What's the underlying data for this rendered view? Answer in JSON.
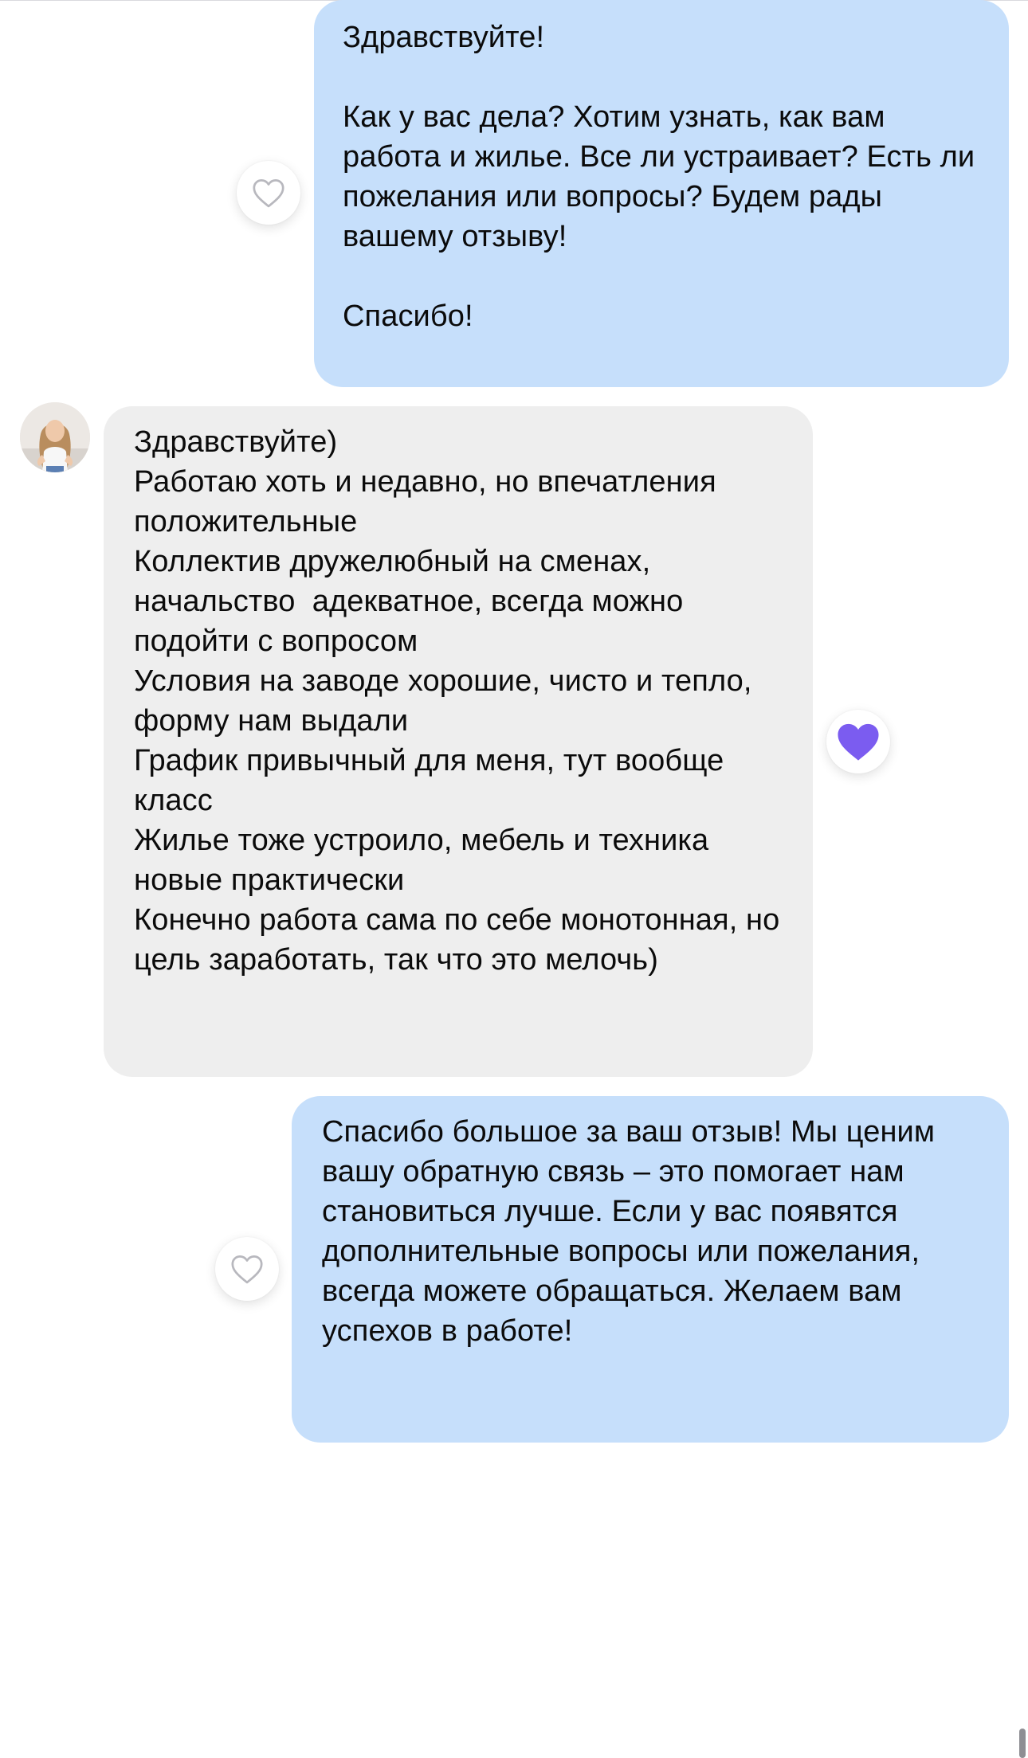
{
  "messages": [
    {
      "direction": "outgoing",
      "text": "Здравствуйте!\n\nКак у вас дела? Хотим узнать, как вам работа и жилье. Все ли устраивает? Есть ли пожелания или вопросы? Будем рады вашему отзыву!\n\nСпасибо!",
      "reaction": "heart-outline-icon"
    },
    {
      "direction": "incoming",
      "text": "Здравствуйте)\nРаботаю хоть и недавно, но впечатления положительные\nКоллектив дружелюбный на сменах, начальство  адекватное, всегда можно подойти с вопросом\nУсловия на заводе хорошие, чисто и тепло, форму нам выдали\nГрафик привычный для меня, тут вообще класс\nЖилье тоже устроило, мебель и техника новые практически\nКонечно работа сама по себе монотонная, но цель заработать, так что это мелочь)",
      "reaction": "heart-filled-icon"
    },
    {
      "direction": "outgoing",
      "text": "Спасибо большое за ваш отзыв! Мы ценим вашу обратную связь – это помогает нам становиться лучше. Если у вас появятся дополнительные вопросы или пожелания, всегда можете обращаться. Желаем вам успехов в работе!",
      "reaction": "heart-outline-icon"
    }
  ],
  "colors": {
    "outgoing_bubble": "#c6dffb",
    "incoming_bubble": "#eeeeee",
    "liked_heart": "#7b5cf0",
    "unliked_heart": "#b8b8be"
  }
}
